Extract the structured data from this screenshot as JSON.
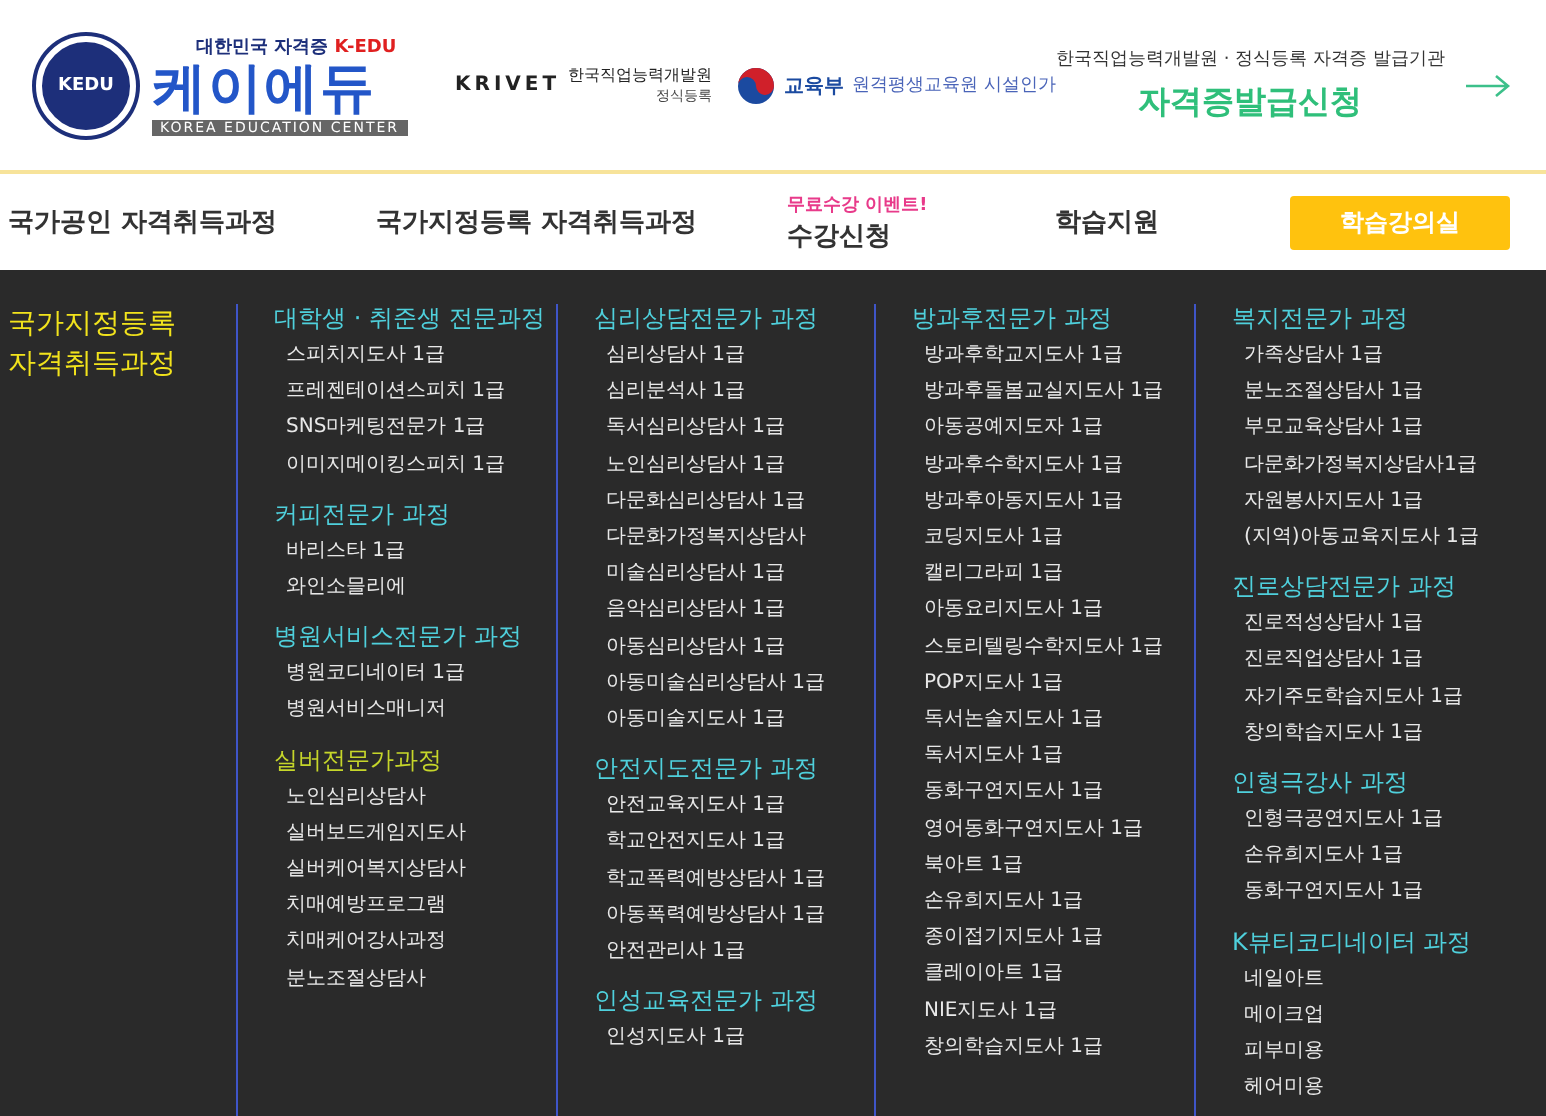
{
  "header": {
    "logo": {
      "badge": "KEDU",
      "tagline": "대한민국 자격증",
      "tagline_accent": "K-EDU",
      "name": "케이에듀",
      "subtitle": "KOREA EDUCATION CENTER"
    },
    "partners": [
      {
        "kind": "krivet",
        "mark": "KRIVET",
        "name": "한국직업능력개발원",
        "note": "정식등록"
      },
      {
        "kind": "moe",
        "mark": "교육부",
        "name": "원격평생교육원 시설인가"
      }
    ],
    "issuer": {
      "caption": "한국직업능력개발원 · 정식등록 자격증 발급기관",
      "link": "자격증발급신청"
    }
  },
  "nav": [
    {
      "kind": "link",
      "label": "국가공인 자격취득과정"
    },
    {
      "kind": "link",
      "label": "국가지정등록 자격취득과정"
    },
    {
      "kind": "event",
      "badge": "무료수강 이벤트!",
      "label": "수강신청"
    },
    {
      "kind": "link",
      "label": "학습지원"
    },
    {
      "kind": "button",
      "label": "학습강의실"
    }
  ],
  "menu": {
    "title": "국가지정등록\n자격취득과정",
    "columns": [
      [
        {
          "heading": "대학생 · 취준생 전문과정",
          "color": "#4fd0dc",
          "items": [
            "스피치지도사 1급",
            "프레젠테이션스피치 1급",
            "SNS마케팅전문가 1급",
            "이미지메이킹스피치 1급"
          ]
        },
        {
          "heading": "커피전문가 과정",
          "color": "#4fd0dc",
          "items": [
            "바리스타 1급",
            "와인소믈리에"
          ]
        },
        {
          "heading": "병원서비스전문가 과정",
          "color": "#4fd0dc",
          "items": [
            "병원코디네이터 1급",
            "병원서비스매니저"
          ]
        },
        {
          "heading": "실버전문가과정",
          "color": "#c6d62a",
          "items": [
            "노인심리상담사",
            "실버보드게임지도사",
            "실버케어복지상담사",
            "치매예방프로그램",
            "치매케어강사과정",
            "분노조절상담사"
          ]
        }
      ],
      [
        {
          "heading": "심리상담전문가 과정",
          "color": "#4fd0dc",
          "items": [
            "심리상담사 1급",
            "심리분석사 1급",
            "독서심리상담사 1급",
            "노인심리상담사 1급",
            "다문화심리상담사 1급",
            "다문화가정복지상담사",
            "미술심리상담사 1급",
            "음악심리상담사 1급",
            "아동심리상담사 1급",
            "아동미술심리상담사 1급",
            "아동미술지도사 1급"
          ]
        },
        {
          "heading": "안전지도전문가 과정",
          "color": "#4fd0dc",
          "items": [
            "안전교육지도사 1급",
            "학교안전지도사 1급",
            "학교폭력예방상담사 1급",
            "아동폭력예방상담사 1급",
            "안전관리사 1급"
          ]
        },
        {
          "heading": "인성교육전문가 과정",
          "color": "#4fd0dc",
          "items": [
            "인성지도사 1급"
          ]
        }
      ],
      [
        {
          "heading": "방과후전문가 과정",
          "color": "#4fd0dc",
          "items": [
            "방과후학교지도사 1급",
            "방과후돌봄교실지도사 1급",
            "아동공예지도자 1급",
            "방과후수학지도사 1급",
            "방과후아동지도사 1급",
            "코딩지도사 1급",
            "캘리그라피 1급",
            "아동요리지도사 1급",
            "스토리텔링수학지도사 1급",
            "POP지도사 1급",
            "독서논술지도사 1급",
            "독서지도사 1급",
            "동화구연지도사 1급",
            "영어동화구연지도사 1급",
            "북아트 1급",
            "손유희지도사 1급",
            "종이접기지도사 1급",
            "클레이아트 1급",
            "NIE지도사 1급",
            "창의학습지도사 1급"
          ]
        }
      ],
      [
        {
          "heading": "복지전문가 과정",
          "color": "#4fd0dc",
          "items": [
            "가족상담사 1급",
            "분노조절상담사 1급",
            "부모교육상담사 1급",
            "다문화가정복지상담사1급",
            "자원봉사지도사 1급",
            "(지역)아동교육지도사 1급"
          ]
        },
        {
          "heading": "진로상담전문가 과정",
          "color": "#4fd0dc",
          "items": [
            "진로적성상담사 1급",
            "진로직업상담사 1급",
            "자기주도학습지도사 1급",
            "창의학습지도사 1급"
          ]
        },
        {
          "heading": "인형극강사 과정",
          "color": "#4fd0dc",
          "items": [
            "인형극공연지도사 1급",
            "손유희지도사 1급",
            "동화구연지도사 1급"
          ]
        },
        {
          "heading": "K뷰티코디네이터 과정",
          "color": "#4fd0dc",
          "items": [
            "네일아트",
            "메이크업",
            "피부미용",
            "헤어미용"
          ]
        }
      ]
    ]
  }
}
